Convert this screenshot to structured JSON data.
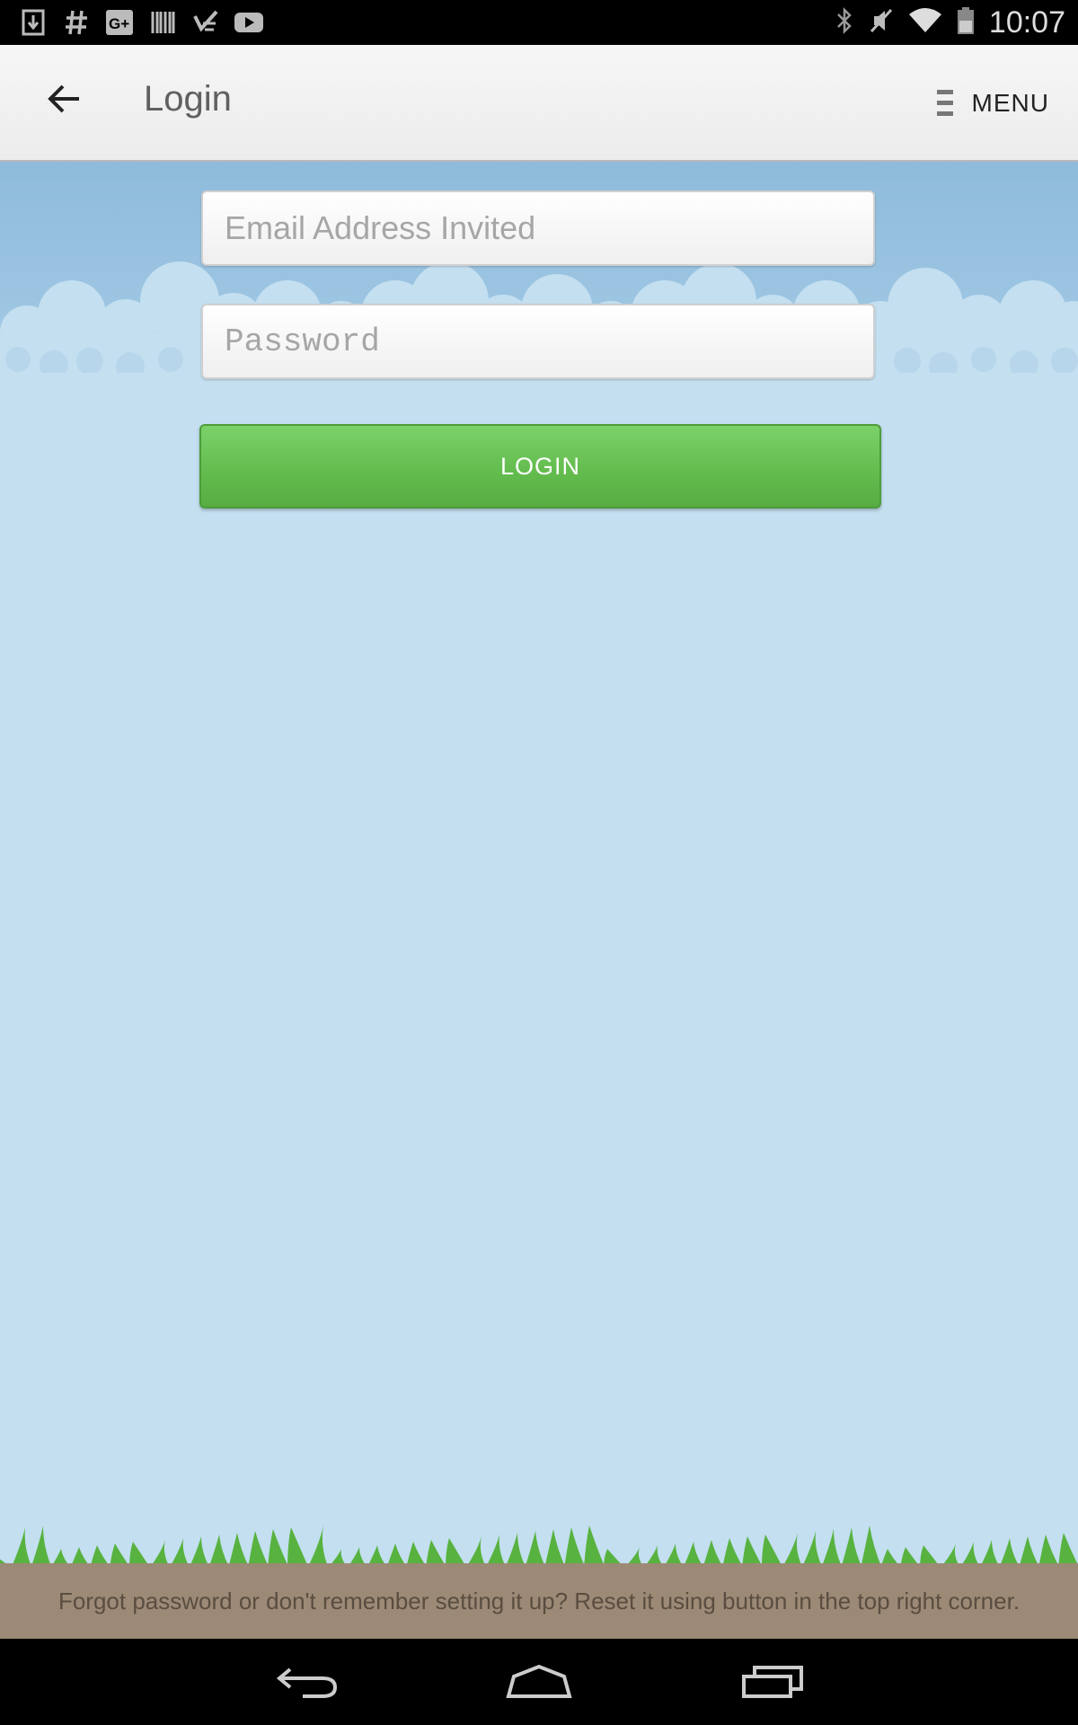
{
  "status_bar": {
    "time": "10:07",
    "left_icons": [
      "download-icon",
      "hashtag-icon",
      "google-plus-icon",
      "barcode-icon",
      "check-app-icon",
      "youtube-icon"
    ],
    "right_icons": [
      "bluetooth-icon",
      "mute-icon",
      "wifi-icon",
      "battery-icon"
    ]
  },
  "app_bar": {
    "title": "Login",
    "menu_label": "MENU"
  },
  "form": {
    "email_placeholder": "Email Address Invited",
    "password_placeholder": "Password",
    "login_label": "LOGIN"
  },
  "footer": {
    "text": "Forgot password or don't remember setting it up? Reset it using button in the top right corner."
  },
  "colors": {
    "sky": "#c3dff0",
    "login_button": "#62bb4d",
    "footer": "#9c8a76"
  }
}
